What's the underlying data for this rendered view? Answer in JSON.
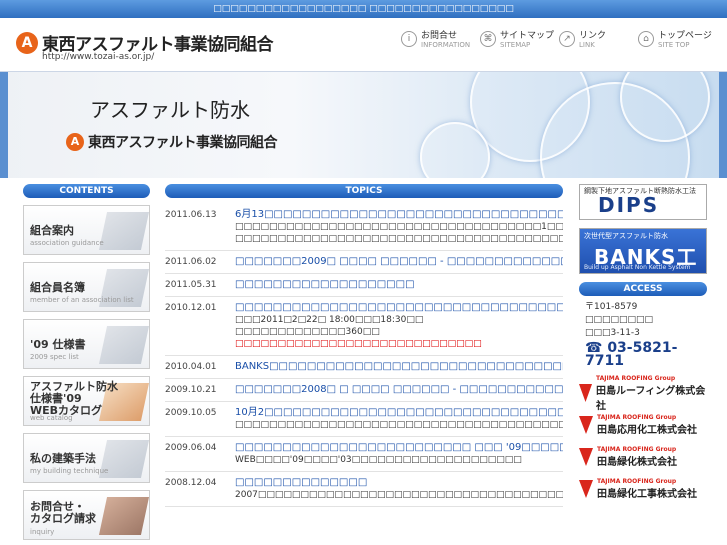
{
  "topbar": {
    "text": "□□□□□□□□□□□□□□□□□□ □□□□□□□□□□□□□□□□□"
  },
  "header": {
    "logo_mark": "A",
    "logo_text": "東西アスファルト事業協同組合",
    "url": "http://www.tozai-as.or.jp/",
    "nav": [
      {
        "jp": "お問合せ",
        "en": "INFORMATION",
        "icon": "info-icon",
        "glyph": "i"
      },
      {
        "jp": "サイトマップ",
        "en": "SITEMAP",
        "icon": "sitemap-icon",
        "glyph": "⌘"
      },
      {
        "jp": "リンク",
        "en": "LINK",
        "icon": "link-icon",
        "glyph": "↗"
      },
      {
        "jp": "トップページ",
        "en": "SITE TOP",
        "icon": "home-icon",
        "glyph": "⌂"
      }
    ]
  },
  "hero": {
    "title": "アスファルト防水",
    "brand": "東西アスファルト事業協同組合"
  },
  "contents": {
    "heading": "CONTENTS",
    "cards": [
      {
        "title": "組合案内",
        "sub": "association guidance"
      },
      {
        "title": "組合員名簿",
        "sub": "member of an association list"
      },
      {
        "title": "'09 仕様書",
        "sub": "2009 spec list"
      },
      {
        "title": "アスファルト防水\n仕様書'09\nWEBカタログ",
        "sub": "web catalog"
      },
      {
        "title": "私の建築手法",
        "sub": "my building technique"
      },
      {
        "title": "お問合せ・\nカタログ請求",
        "sub": "inquiry"
      }
    ]
  },
  "topics": {
    "heading": "TOPICS",
    "items": [
      {
        "date": "2011.06.13",
        "link": "6月13□□□□□□□□□□□□□□□□□□□□□□□□□□□□□□□□",
        "lines": [
          "□□□□□□□□□□□□□□□□□□□□□□□□□□□□□□□□□□□□1□□□□□□□□□□□□□□□",
          "□□□□□□□□□□□□□□□□□□□□□□□□□□□□□□□□□□□□□□□□□□"
        ],
        "red": ""
      },
      {
        "date": "2011.06.02",
        "link": "□□□□□□□2009□ □□□□ □□□□□□ - □□□□□□□□□□□□□□□□□□□□□□□□",
        "lines": [],
        "red": ""
      },
      {
        "date": "2011.05.31",
        "link": "□□□□□□□□□□□□□□□□□□□",
        "lines": [],
        "red": ""
      },
      {
        "date": "2010.12.01",
        "link": "□□□□□□□□□□□□□□□□□□□□□□□□□□□□□□□□□□□□□□",
        "lines": [
          "□□□2011□2□22□ 18:00□□□18:30□□",
          "□□□□□□□□□□□□□360□□"
        ],
        "red": "□□□□□□□□□□□□□□□□□□□□□□□□□□□□□"
      },
      {
        "date": "2010.04.01",
        "link": "BANKS□□□□□□□□□□□□□□□□□□□□□□□□□□□□□□□□□□□□□□",
        "lines": [],
        "red": ""
      },
      {
        "date": "2009.10.21",
        "link": "□□□□□□□2008□ □ □□□□ □□□□□□ - □□□□□□□□□□□□□□□□□□□□□□□□□□",
        "lines": [],
        "red": ""
      },
      {
        "date": "2009.10.05",
        "link": "10月2□□□□□□□□□□□□□□□□□□□□□□□□□□□□□□□□□□□□□□",
        "lines": [
          "□□□□□□□□□□□□□□□□□□□□□□□□□□□□□□□□□□□□□□□□□□□□"
        ],
        "red": ""
      },
      {
        "date": "2009.06.04",
        "link": "□□□□□□□□□□□□□□□□□□□□□□□□□ □□□ '09□□□□□□□□□□□□□□□□□",
        "lines": [
          "WEB□□□□'09□□□□'03□□□□□□□□□□□□□□□□□□□□"
        ],
        "red": ""
      },
      {
        "date": "2008.12.04",
        "link": "□□□□□□□□□□□□□□",
        "lines": [
          "2007□□□□□□□□□□□□□□□□□□□□□□□□□□□□□□□□□□□□□□□□□□□□□□"
        ],
        "red": ""
      }
    ]
  },
  "banners": {
    "dips_small": "鋼製下地アスファルト断熱防水工法",
    "dips_big": "DIPS",
    "banks_small": "次世代型アスファルト防水",
    "banks_big": "BANKS工法",
    "banks_foot": "Build up Asphalt Non Kettle System"
  },
  "access": {
    "heading": "ACCESS",
    "lines": [
      "〒101-8579",
      "□□□□□□□□",
      "□□□3-11-3"
    ],
    "phone": "☎ 03-5821-7711"
  },
  "group": {
    "tag": "TAJIMA ROOFING Group",
    "companies": [
      "田島ルーフィング株式会社",
      "田島応用化工株式会社",
      "田島緑化株式会社",
      "田島緑化工事株式会社"
    ]
  },
  "colors": {
    "accent": "#1a4fa8",
    "brand_orange": "#e8641a",
    "group_red": "#d9261c"
  }
}
